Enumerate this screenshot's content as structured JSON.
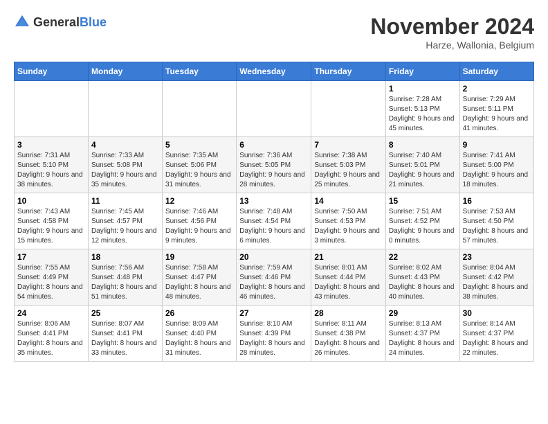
{
  "header": {
    "logo_general": "General",
    "logo_blue": "Blue",
    "month_title": "November 2024",
    "location": "Harze, Wallonia, Belgium"
  },
  "days_of_week": [
    "Sunday",
    "Monday",
    "Tuesday",
    "Wednesday",
    "Thursday",
    "Friday",
    "Saturday"
  ],
  "weeks": [
    [
      {
        "day": "",
        "info": ""
      },
      {
        "day": "",
        "info": ""
      },
      {
        "day": "",
        "info": ""
      },
      {
        "day": "",
        "info": ""
      },
      {
        "day": "",
        "info": ""
      },
      {
        "day": "1",
        "info": "Sunrise: 7:28 AM\nSunset: 5:13 PM\nDaylight: 9 hours and 45 minutes."
      },
      {
        "day": "2",
        "info": "Sunrise: 7:29 AM\nSunset: 5:11 PM\nDaylight: 9 hours and 41 minutes."
      }
    ],
    [
      {
        "day": "3",
        "info": "Sunrise: 7:31 AM\nSunset: 5:10 PM\nDaylight: 9 hours and 38 minutes."
      },
      {
        "day": "4",
        "info": "Sunrise: 7:33 AM\nSunset: 5:08 PM\nDaylight: 9 hours and 35 minutes."
      },
      {
        "day": "5",
        "info": "Sunrise: 7:35 AM\nSunset: 5:06 PM\nDaylight: 9 hours and 31 minutes."
      },
      {
        "day": "6",
        "info": "Sunrise: 7:36 AM\nSunset: 5:05 PM\nDaylight: 9 hours and 28 minutes."
      },
      {
        "day": "7",
        "info": "Sunrise: 7:38 AM\nSunset: 5:03 PM\nDaylight: 9 hours and 25 minutes."
      },
      {
        "day": "8",
        "info": "Sunrise: 7:40 AM\nSunset: 5:01 PM\nDaylight: 9 hours and 21 minutes."
      },
      {
        "day": "9",
        "info": "Sunrise: 7:41 AM\nSunset: 5:00 PM\nDaylight: 9 hours and 18 minutes."
      }
    ],
    [
      {
        "day": "10",
        "info": "Sunrise: 7:43 AM\nSunset: 4:58 PM\nDaylight: 9 hours and 15 minutes."
      },
      {
        "day": "11",
        "info": "Sunrise: 7:45 AM\nSunset: 4:57 PM\nDaylight: 9 hours and 12 minutes."
      },
      {
        "day": "12",
        "info": "Sunrise: 7:46 AM\nSunset: 4:56 PM\nDaylight: 9 hours and 9 minutes."
      },
      {
        "day": "13",
        "info": "Sunrise: 7:48 AM\nSunset: 4:54 PM\nDaylight: 9 hours and 6 minutes."
      },
      {
        "day": "14",
        "info": "Sunrise: 7:50 AM\nSunset: 4:53 PM\nDaylight: 9 hours and 3 minutes."
      },
      {
        "day": "15",
        "info": "Sunrise: 7:51 AM\nSunset: 4:52 PM\nDaylight: 9 hours and 0 minutes."
      },
      {
        "day": "16",
        "info": "Sunrise: 7:53 AM\nSunset: 4:50 PM\nDaylight: 8 hours and 57 minutes."
      }
    ],
    [
      {
        "day": "17",
        "info": "Sunrise: 7:55 AM\nSunset: 4:49 PM\nDaylight: 8 hours and 54 minutes."
      },
      {
        "day": "18",
        "info": "Sunrise: 7:56 AM\nSunset: 4:48 PM\nDaylight: 8 hours and 51 minutes."
      },
      {
        "day": "19",
        "info": "Sunrise: 7:58 AM\nSunset: 4:47 PM\nDaylight: 8 hours and 48 minutes."
      },
      {
        "day": "20",
        "info": "Sunrise: 7:59 AM\nSunset: 4:46 PM\nDaylight: 8 hours and 46 minutes."
      },
      {
        "day": "21",
        "info": "Sunrise: 8:01 AM\nSunset: 4:44 PM\nDaylight: 8 hours and 43 minutes."
      },
      {
        "day": "22",
        "info": "Sunrise: 8:02 AM\nSunset: 4:43 PM\nDaylight: 8 hours and 40 minutes."
      },
      {
        "day": "23",
        "info": "Sunrise: 8:04 AM\nSunset: 4:42 PM\nDaylight: 8 hours and 38 minutes."
      }
    ],
    [
      {
        "day": "24",
        "info": "Sunrise: 8:06 AM\nSunset: 4:41 PM\nDaylight: 8 hours and 35 minutes."
      },
      {
        "day": "25",
        "info": "Sunrise: 8:07 AM\nSunset: 4:41 PM\nDaylight: 8 hours and 33 minutes."
      },
      {
        "day": "26",
        "info": "Sunrise: 8:09 AM\nSunset: 4:40 PM\nDaylight: 8 hours and 31 minutes."
      },
      {
        "day": "27",
        "info": "Sunrise: 8:10 AM\nSunset: 4:39 PM\nDaylight: 8 hours and 28 minutes."
      },
      {
        "day": "28",
        "info": "Sunrise: 8:11 AM\nSunset: 4:38 PM\nDaylight: 8 hours and 26 minutes."
      },
      {
        "day": "29",
        "info": "Sunrise: 8:13 AM\nSunset: 4:37 PM\nDaylight: 8 hours and 24 minutes."
      },
      {
        "day": "30",
        "info": "Sunrise: 8:14 AM\nSunset: 4:37 PM\nDaylight: 8 hours and 22 minutes."
      }
    ]
  ]
}
